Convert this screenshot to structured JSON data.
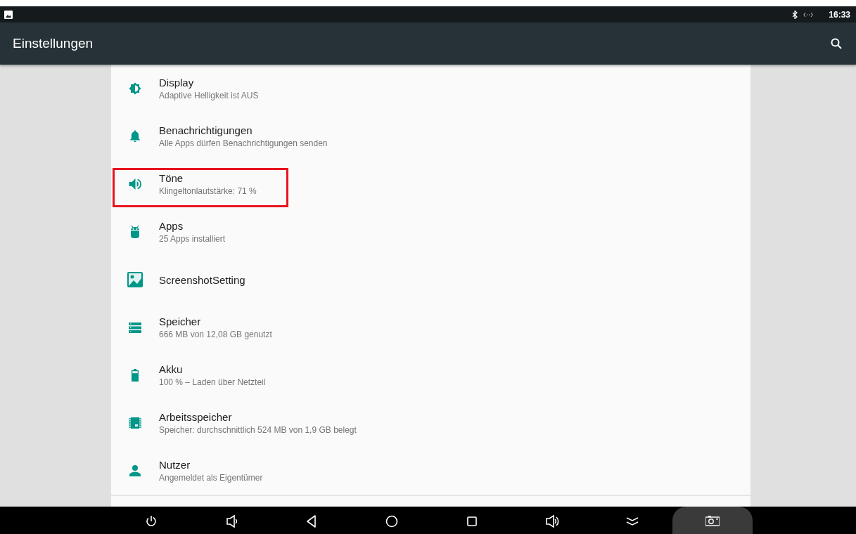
{
  "status_bar": {
    "time": "16:33"
  },
  "toolbar": {
    "title": "Einstellungen"
  },
  "settings": [
    {
      "kind": "display",
      "title": "Display",
      "summary": "Adaptive Helligkeit ist AUS",
      "highlighted": false
    },
    {
      "kind": "notifications",
      "title": "Benachrichtigungen",
      "summary": "Alle Apps dürfen Benachrichtigungen senden",
      "highlighted": false
    },
    {
      "kind": "sound",
      "title": "Töne",
      "summary": "Klingeltonlautstärke: 71 %",
      "highlighted": true
    },
    {
      "kind": "apps",
      "title": "Apps",
      "summary": "25 Apps installiert",
      "highlighted": false
    },
    {
      "kind": "screenshot",
      "title": "ScreenshotSetting",
      "highlighted": false
    },
    {
      "kind": "storage",
      "title": "Speicher",
      "summary": "666 MB von 12,08 GB genutzt",
      "highlighted": false
    },
    {
      "kind": "battery",
      "title": "Akku",
      "summary": "100 % – Laden über Netzteil",
      "highlighted": false
    },
    {
      "kind": "memory",
      "title": "Arbeitsspeicher",
      "summary": "Speicher: durchschnittlich 524 MB von 1,9 GB belegt",
      "highlighted": false
    },
    {
      "kind": "user",
      "title": "Nutzer",
      "summary": "Angemeldet als Eigentümer",
      "highlighted": false
    }
  ],
  "nav_bar": [
    {
      "kind": "power"
    },
    {
      "kind": "volume-down"
    },
    {
      "kind": "back"
    },
    {
      "kind": "home"
    },
    {
      "kind": "recents"
    },
    {
      "kind": "volume-up"
    },
    {
      "kind": "collapse"
    },
    {
      "kind": "screenshot"
    }
  ]
}
